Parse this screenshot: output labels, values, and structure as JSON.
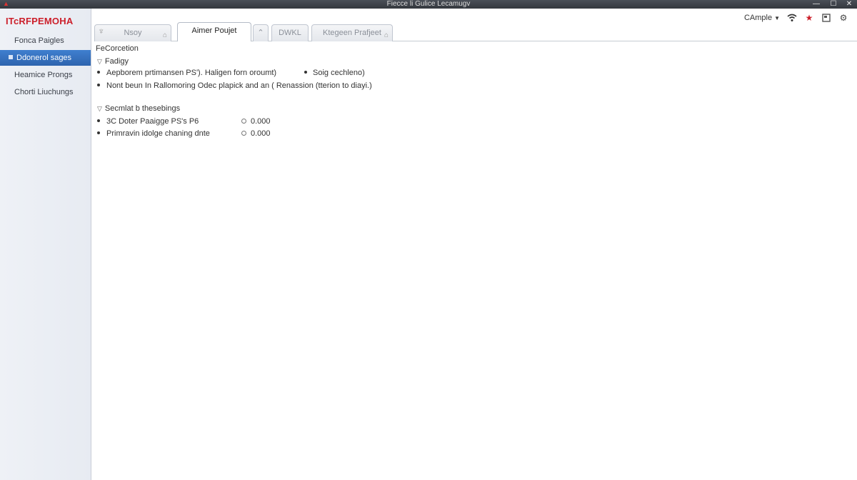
{
  "window": {
    "title": "Fiecce li Gulice Lecamugv",
    "minimize_glyph": "—",
    "maximize_glyph": "☐",
    "close_glyph": "✕"
  },
  "sidebar": {
    "brand": "ITcRFPEMOHA",
    "items": [
      {
        "label": "Fonca Paigles",
        "active": false
      },
      {
        "label": "Ddonerol sages",
        "active": true
      },
      {
        "label": "Heamice Prongs",
        "active": false
      },
      {
        "label": "Chorti Liuchungs",
        "active": false
      }
    ]
  },
  "toolbar": {
    "user_label": "CAmple",
    "caret": "▼"
  },
  "tabs": [
    {
      "label": "Nsoy",
      "active": false
    },
    {
      "label": "Aimer Poujet",
      "active": true
    },
    {
      "label": "",
      "active": false
    },
    {
      "label": "DWKL",
      "active": false
    },
    {
      "label": "Ktegeen Prafjeet",
      "active": false
    }
  ],
  "content": {
    "section_title": "FeCorcetion",
    "groups": [
      {
        "title": "Fadigy",
        "items": [
          {
            "text": "Aepborem prtimansen PS'). Haligen forn oroumt)",
            "extra": "Soig cechleno)"
          },
          {
            "text": "Nont beun In Rallomoring Odec plapick and an ( Renassion (tterion to diayi.)",
            "extra": ""
          }
        ]
      },
      {
        "title": "Secmlat b thesebings",
        "items": [
          {
            "text": "3C Doter Paaigge PS's P6",
            "value": "0.000"
          },
          {
            "text": "Primravin idolge chaning dnte",
            "value": "0.000"
          }
        ]
      }
    ]
  },
  "icons": {
    "app": "app-icon",
    "toggle": "chevron-down-icon",
    "pin": "pin-icon",
    "home": "home-icon",
    "tab_close": "close-icon",
    "wifi": "wifi-icon",
    "star": "star-icon",
    "box": "box-icon",
    "gear": "gear-icon"
  },
  "colors": {
    "brand": "#cc1f2a",
    "active_nav": "#2e64ae",
    "star": "#cc1f2a"
  }
}
